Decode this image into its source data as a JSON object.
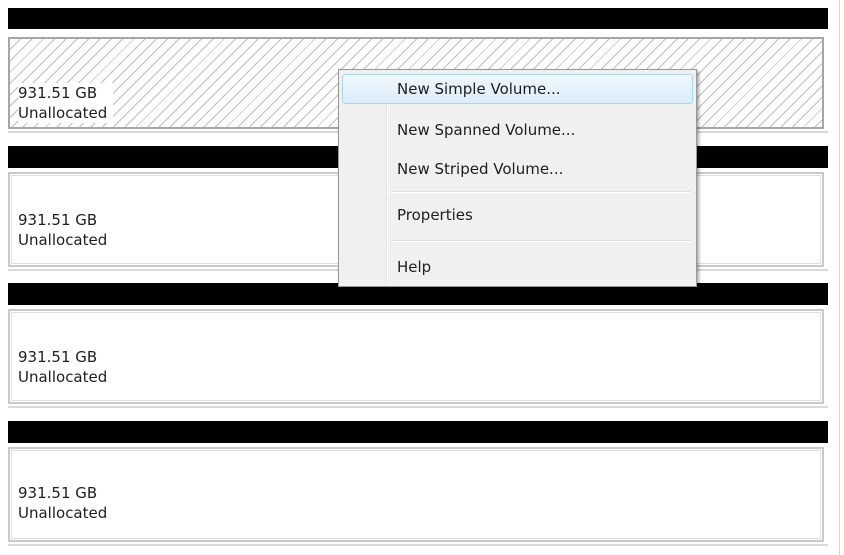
{
  "disks": [
    {
      "size": "931.51 GB",
      "status": "Unallocated",
      "selected": true
    },
    {
      "size": "931.51 GB",
      "status": "Unallocated",
      "selected": false
    },
    {
      "size": "931.51 GB",
      "status": "Unallocated",
      "selected": false
    },
    {
      "size": "931.51 GB",
      "status": "Unallocated",
      "selected": false
    }
  ],
  "context_menu": {
    "items": [
      {
        "label": "New Simple Volume...",
        "highlighted": true
      },
      {
        "label": "New Spanned Volume..."
      },
      {
        "label": "New Striped Volume..."
      },
      {
        "label": "Properties"
      },
      {
        "label": "Help"
      }
    ]
  },
  "colors": {
    "disk_header": "#000000",
    "menu_highlight_border": "#a8d8eb",
    "menu_background": "#f0f0f0"
  }
}
